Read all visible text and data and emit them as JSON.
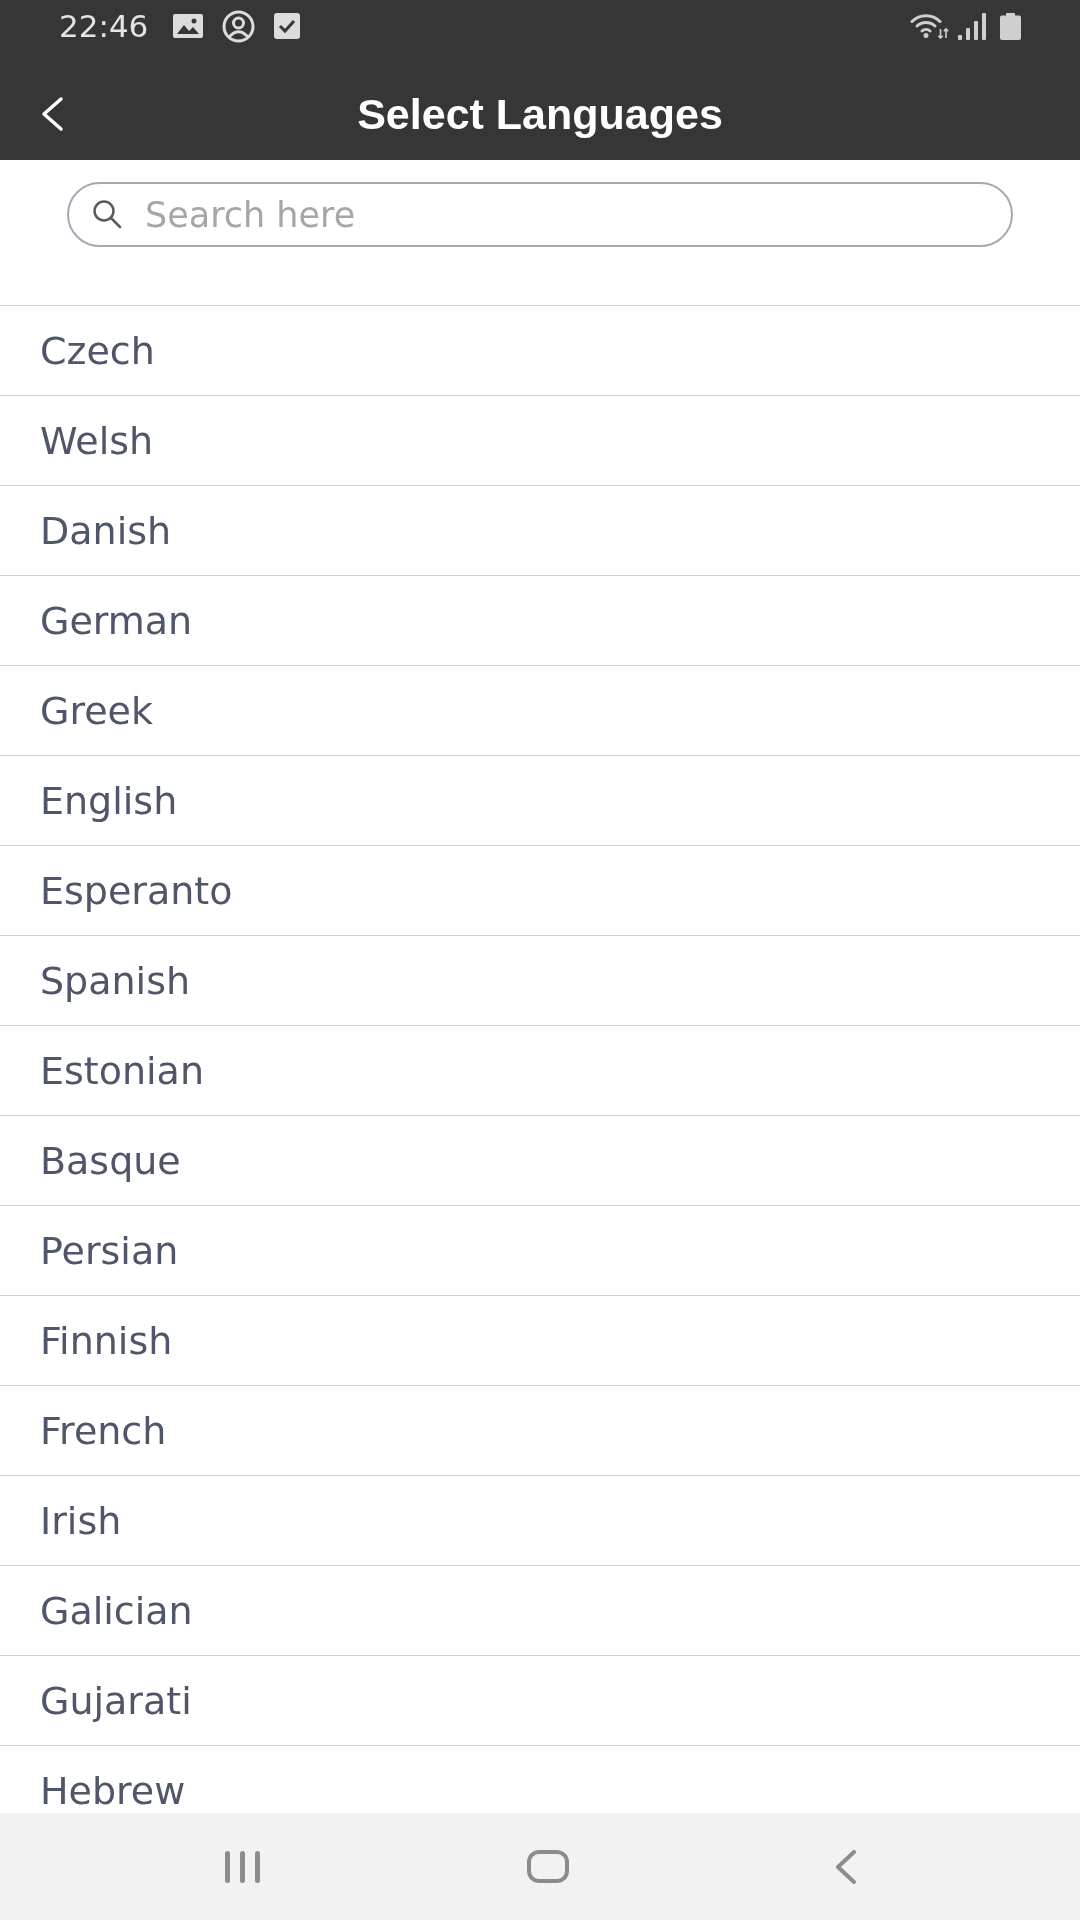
{
  "status_bar": {
    "time": "22:46"
  },
  "header": {
    "title": "Select Languages"
  },
  "search": {
    "placeholder": "Search here"
  },
  "languages": [
    "Czech",
    "Welsh",
    "Danish",
    "German",
    "Greek",
    "English",
    "Esperanto",
    "Spanish",
    "Estonian",
    "Basque",
    "Persian",
    "Finnish",
    "French",
    "Irish",
    "Galician",
    "Gujarati",
    "Hebrew"
  ]
}
